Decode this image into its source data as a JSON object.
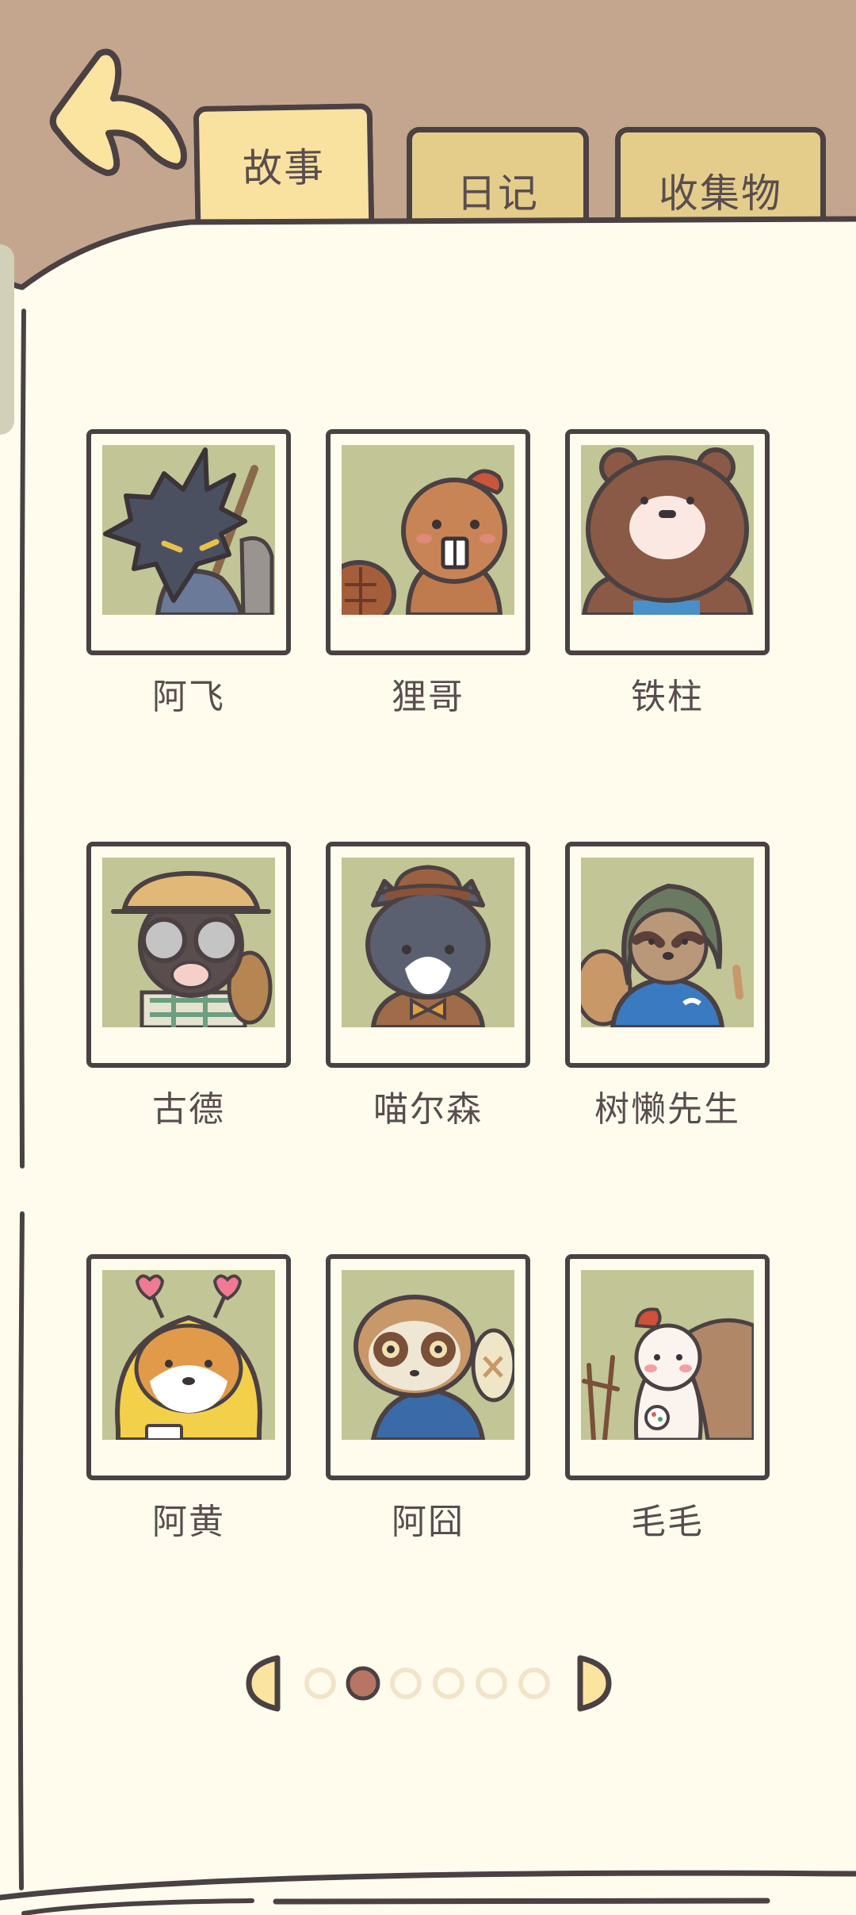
{
  "header": {
    "back_icon": "back-arrow-icon",
    "tabs": [
      {
        "label": "故事",
        "selected": true
      },
      {
        "label": "日记",
        "selected": false
      },
      {
        "label": "收集物",
        "selected": false
      }
    ]
  },
  "characters": [
    {
      "name": "阿飞",
      "portrait": "wolf-portrait"
    },
    {
      "name": "狸哥",
      "portrait": "beaver-portrait"
    },
    {
      "name": "铁柱",
      "portrait": "bear-portrait"
    },
    {
      "name": "古德",
      "portrait": "mole-portrait"
    },
    {
      "name": "喵尔森",
      "portrait": "cat-portrait"
    },
    {
      "name": "树懒先生",
      "portrait": "sloth-portrait"
    },
    {
      "name": "阿黄",
      "portrait": "shiba-portrait"
    },
    {
      "name": "阿囧",
      "portrait": "loris-portrait"
    },
    {
      "name": "毛毛",
      "portrait": "alpaca-portrait"
    }
  ],
  "pagination": {
    "total_pages": 6,
    "current_page": 2,
    "prev_icon": "prev-page-icon",
    "next_icon": "next-page-icon"
  },
  "colors": {
    "outer_background": "#c4a68e",
    "page_paper": "#fffcee",
    "outline": "#4b4143",
    "selected_tab": "#f9e1a0",
    "tab": "#e4cd8a",
    "photo_background": "#c2c595",
    "text": "#5a4d4e",
    "dot_active": "#b87564",
    "dot_inactive": "#f2e4c8"
  }
}
